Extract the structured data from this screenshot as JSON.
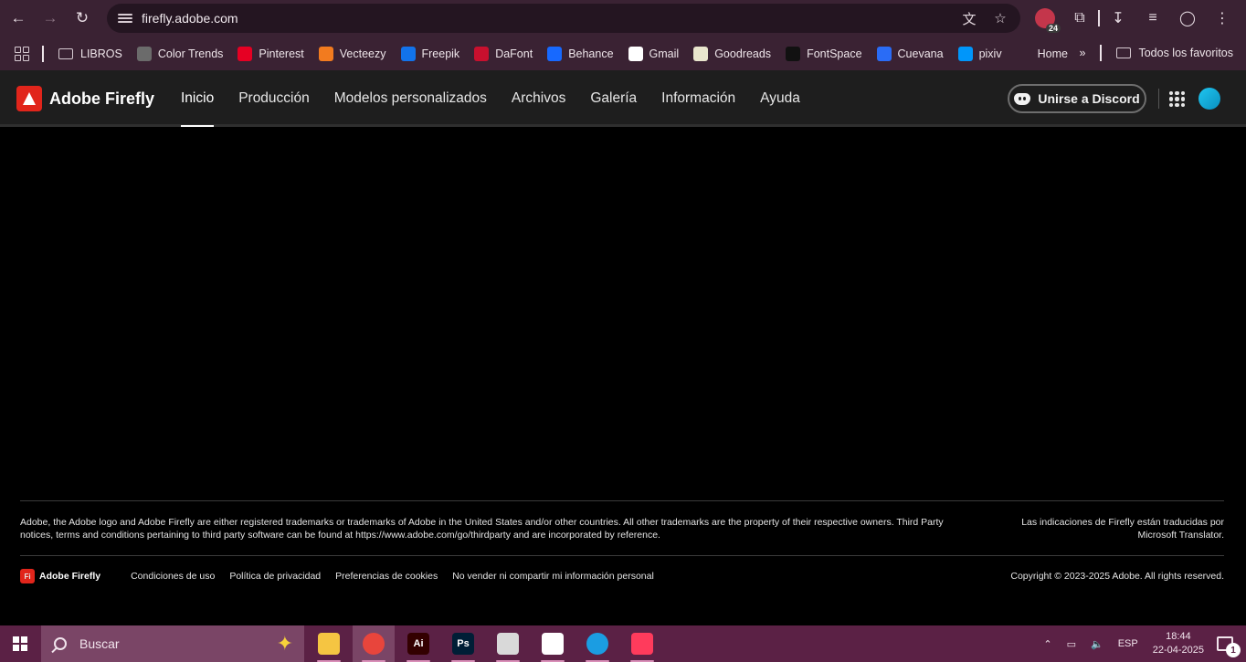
{
  "browser": {
    "url": "firefly.adobe.com",
    "extension_badge": "24",
    "bookmarks": [
      {
        "label": "LIBROS",
        "icon": "folder-icon",
        "color": ""
      },
      {
        "label": "Color Trends",
        "icon": "color-trends-icon",
        "color": "#6b6b6b"
      },
      {
        "label": "Pinterest",
        "icon": "pinterest-icon",
        "color": "#e60023"
      },
      {
        "label": "Vecteezy",
        "icon": "vecteezy-icon",
        "color": "#f27b1f"
      },
      {
        "label": "Freepik",
        "icon": "freepik-icon",
        "color": "#1273eb"
      },
      {
        "label": "DaFont",
        "icon": "dafont-icon",
        "color": "#c8102e"
      },
      {
        "label": "Behance",
        "icon": "behance-icon",
        "color": "#1769ff"
      },
      {
        "label": "Gmail",
        "icon": "google-icon",
        "color": "#ffffff"
      },
      {
        "label": "Goodreads",
        "icon": "goodreads-icon",
        "color": "#e9e5cd"
      },
      {
        "label": "FontSpace",
        "icon": "fontspace-icon",
        "color": "#111111"
      },
      {
        "label": "Cuevana",
        "icon": "cuevana-icon",
        "color": "#2a6cf6"
      },
      {
        "label": "pixiv",
        "icon": "pixiv-icon",
        "color": "#0096fa"
      },
      {
        "label": "Home",
        "icon": "home-t-icon",
        "color": "#3a2233"
      }
    ],
    "all_bookmarks": "Todos los favoritos"
  },
  "app": {
    "brand": "Adobe Firefly",
    "nav": [
      "Inicio",
      "Producción",
      "Modelos personalizados",
      "Archivos",
      "Galería",
      "Información",
      "Ayuda"
    ],
    "active_nav": "Inicio",
    "discord_button": "Unirse a Discord",
    "accent_color": "#e1251b"
  },
  "footer": {
    "legal": "Adobe, the Adobe logo and Adobe Firefly are either registered trademarks or trademarks of Adobe in the United States and/or other countries. All other trademarks are the property of their respective owners. Third Party notices, terms and conditions pertaining to third party software can be found at https://www.adobe.com/go/thirdparty and are incorporated by reference.",
    "translator": "Las indicaciones de Firefly están traducidas por Microsoft Translator.",
    "brand_mark": "Fi",
    "brand": "Adobe Firefly",
    "links": [
      "Condiciones de uso",
      "Política de privacidad",
      "Preferencias de cookies",
      "No vender ni compartir mi información personal"
    ],
    "copyright": "Copyright © 2023-2025 Adobe. All rights reserved."
  },
  "taskbar": {
    "search_placeholder": "Buscar",
    "apps": [
      {
        "name": "file-explorer-icon",
        "label": "",
        "color": "#f5c542"
      },
      {
        "name": "chrome-icon",
        "label": "",
        "color": "#e8453c"
      },
      {
        "name": "illustrator-icon",
        "label": "Ai",
        "color": "#330000"
      },
      {
        "name": "photoshop-icon",
        "label": "Ps",
        "color": "#001e36"
      },
      {
        "name": "app-spiral-icon",
        "label": "",
        "color": "#d9d9d9"
      },
      {
        "name": "app-knot-icon",
        "label": "",
        "color": "#ffffff"
      },
      {
        "name": "edge-icon",
        "label": "",
        "color": "#1b9de2"
      },
      {
        "name": "creative-cloud-icon",
        "label": "",
        "color": "#ff3b5c"
      }
    ],
    "language": "ESP",
    "time": "18:44",
    "date": "22-04-2025",
    "notifications": "1"
  }
}
